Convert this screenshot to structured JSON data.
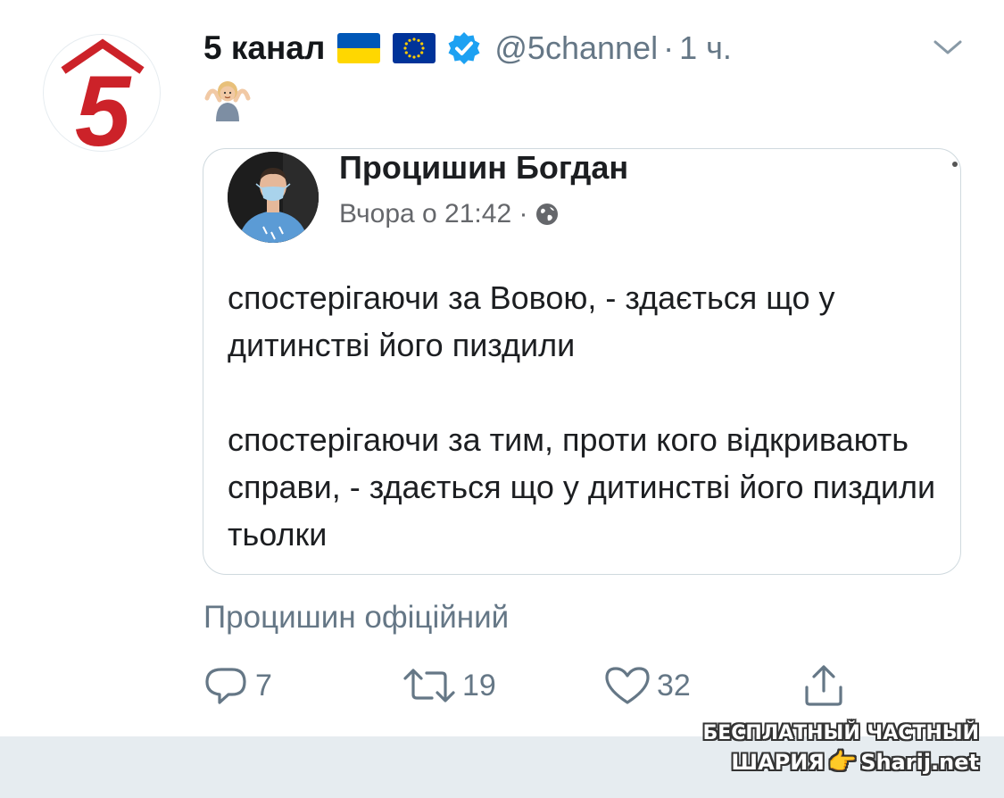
{
  "tweet": {
    "author_name": "5 канал",
    "handle": "@5channel",
    "separator": "·",
    "time": "1 ч.",
    "flags": [
      "ukraine-flag",
      "eu-flag"
    ],
    "verified": true,
    "emoji": "🤷🏼‍♂️",
    "logo_text": "5",
    "source": "Процишин офіційний"
  },
  "embedded_post": {
    "author": "Процишин Богдан",
    "meta": "Вчора о 21:42 ·",
    "paragraphs": [
      "спостерігаючи за Вовою, - здається що у дитинстві його пиздили",
      "спостерігаючи за тим, проти кого відкривають справи, - здається що у дитинстві його пиздили тьолки"
    ]
  },
  "actions": {
    "reply_count": "7",
    "retweet_count": "19",
    "like_count": "32"
  },
  "watermark": {
    "line1": "БЕСПЛАТНЫЙ ЧАСТНЫЙ",
    "line2_left": "ШАРИЯ",
    "line2_hand": "👉",
    "line2_right": "Sharij.net"
  },
  "colors": {
    "logo_red": "#cc2229",
    "verified_blue": "#1da1f2",
    "muted_text": "#657786",
    "ukraine_blue": "#0057b7",
    "ukraine_yellow": "#ffd700",
    "eu_blue": "#003399"
  }
}
